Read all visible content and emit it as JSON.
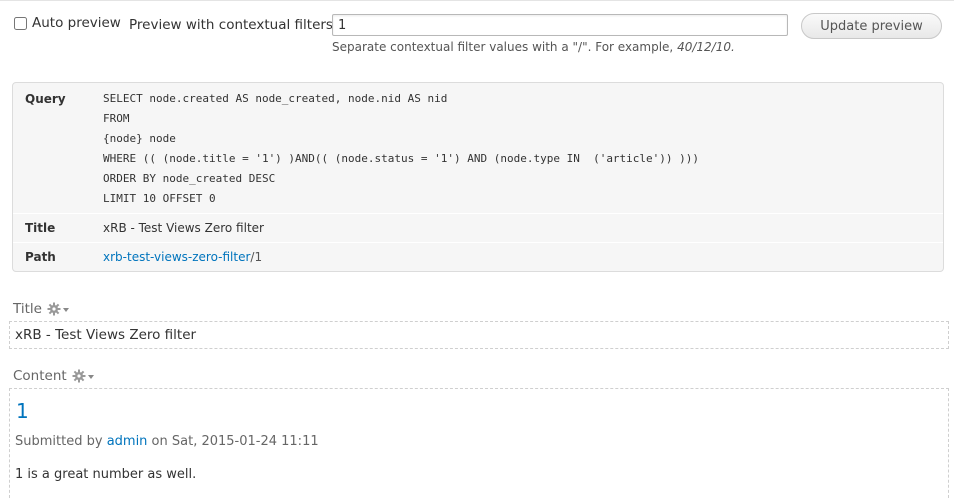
{
  "controls": {
    "auto_preview_label": "Auto preview",
    "contextual_label": "Preview with contextual filters:",
    "contextual_value": "1",
    "contextual_desc_prefix": "Separate contextual filter values with a \"/\". For example, ",
    "contextual_desc_example": "40/12/10.",
    "update_button": "Update preview"
  },
  "query_info": {
    "query_label": "Query",
    "sql_lines": [
      "SELECT node.created AS node_created, node.nid AS nid",
      "FROM",
      "{node} node",
      "WHERE (( (node.title = '1') )AND(( (node.status = '1') AND (node.type IN  ('article')) )))",
      "ORDER BY node_created DESC",
      "LIMIT 10 OFFSET 0"
    ],
    "title_label": "Title",
    "title_value": "xRB - Test Views Zero filter",
    "path_label": "Path",
    "path_link": "xrb-test-views-zero-filter",
    "path_sep": "/",
    "path_arg": "1"
  },
  "title_section": {
    "heading": "Title",
    "value": "xRB - Test Views Zero filter"
  },
  "content_section": {
    "heading": "Content",
    "node_title": "1",
    "submitted_prefix": "Submitted by ",
    "author": "admin",
    "submitted_suffix": " on Sat, 2015-01-24 11:11",
    "body": "1 is a great number as well."
  },
  "icons": {
    "settings": "gear-icon"
  },
  "colors": {
    "link": "#0074bd",
    "panel_bg": "#f6f6f6"
  }
}
